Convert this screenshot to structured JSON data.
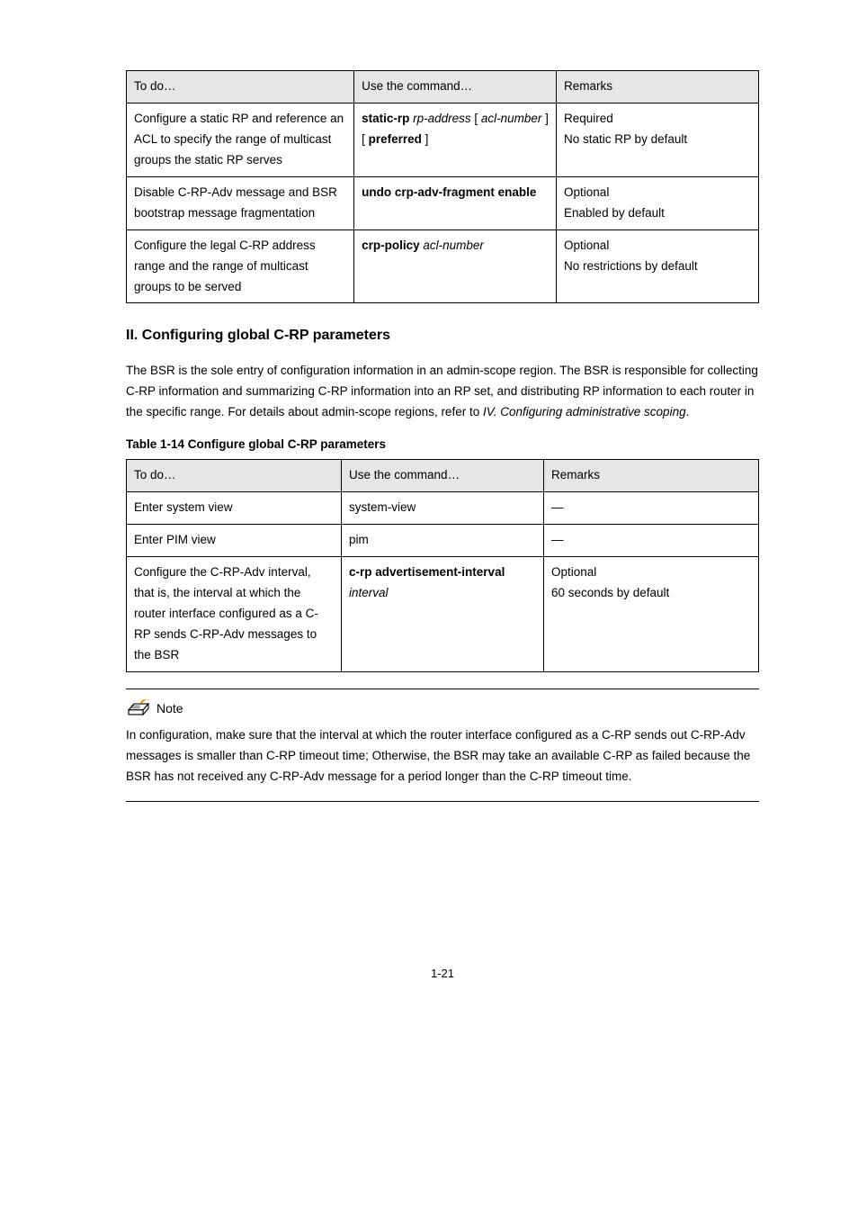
{
  "page_number": "1-21",
  "table1": {
    "headers": [
      "To do…",
      "Use the command…",
      "Remarks"
    ],
    "rows": [
      [
        "Configure a static RP and reference an ACL to specify the range of multicast groups the static RP serves",
        [
          "static-rp ",
          "rp-address",
          " [ ",
          "acl-number",
          " ] [ ",
          "preferred",
          " ]"
        ],
        "Required\nNo static RP by default"
      ],
      [
        "Disable C-RP-Adv message and BSR bootstrap message fragmentation",
        [
          "undo crp-adv-fragment enable"
        ],
        "Optional\nEnabled by default"
      ],
      [
        "Configure the legal C-RP address range and the range of multicast groups to be served",
        [
          "crp-policy ",
          "acl-number"
        ],
        "Optional\nNo restrictions by default"
      ]
    ]
  },
  "section_heading": "II. Configuring global C-RP parameters",
  "section_text_parts": [
    "The BSR is the sole entry of configuration information in an admin-scope region. The BSR is responsible for collecting C-RP information and summarizing C-RP information into an RP set, and distributing RP information to each router in the specific range. For details about admin-scope regions, refer to ",
    "IV. Configuring administrative scoping",
    "."
  ],
  "table2": {
    "caption": "Table 1-14 Configure global C-RP parameters",
    "headers": [
      "To do…",
      "Use the command…",
      "Remarks"
    ],
    "rows": [
      [
        [
          "Enter system view"
        ],
        [
          "system-view"
        ],
        "—"
      ],
      [
        [
          "Enter PIM view"
        ],
        [
          "pim"
        ],
        "—"
      ],
      [
        [
          "Configure the C-RP-Adv interval, that is, the interval at which the router interface configured as a C-RP sends C-RP-Adv messages to the BSR"
        ],
        [
          "c-rp advertisement-interval ",
          "interval"
        ],
        "Optional\n60 seconds by default"
      ]
    ]
  },
  "note": {
    "label": "Note",
    "text": "In configuration, make sure that the interval at which the router interface configured as a C-RP sends out C-RP-Adv messages is smaller than C-RP timeout time; Otherwise, the BSR may take an available C-RP as failed because the BSR has not received any C-RP-Adv message for a period longer than the C-RP timeout time."
  }
}
